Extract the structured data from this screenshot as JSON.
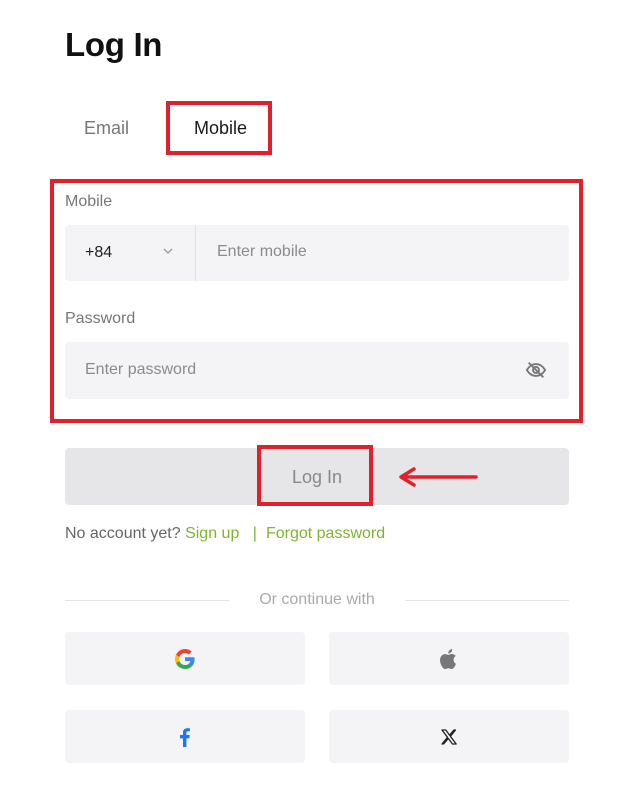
{
  "title": "Log In",
  "tabs": {
    "email": "Email",
    "mobile": "Mobile",
    "selected": "Mobile"
  },
  "mobile": {
    "label": "Mobile",
    "country_code": "+84",
    "placeholder": "Enter mobile"
  },
  "password": {
    "label": "Password",
    "placeholder": "Enter password"
  },
  "login_button": "Log In",
  "links": {
    "no_account": "No account yet?",
    "sign_up": "Sign up",
    "separator": "|",
    "forgot": "Forgot password"
  },
  "divider_text": "Or continue with",
  "social": {
    "google_icon": "google-icon",
    "apple_icon": "apple-icon",
    "facebook_icon": "facebook-icon",
    "x_icon": "x-icon"
  },
  "colors": {
    "highlight": "#e0202b",
    "link_green": "#7db52e",
    "field_bg": "#f4f4f6",
    "button_bg": "#e6e6e8"
  }
}
